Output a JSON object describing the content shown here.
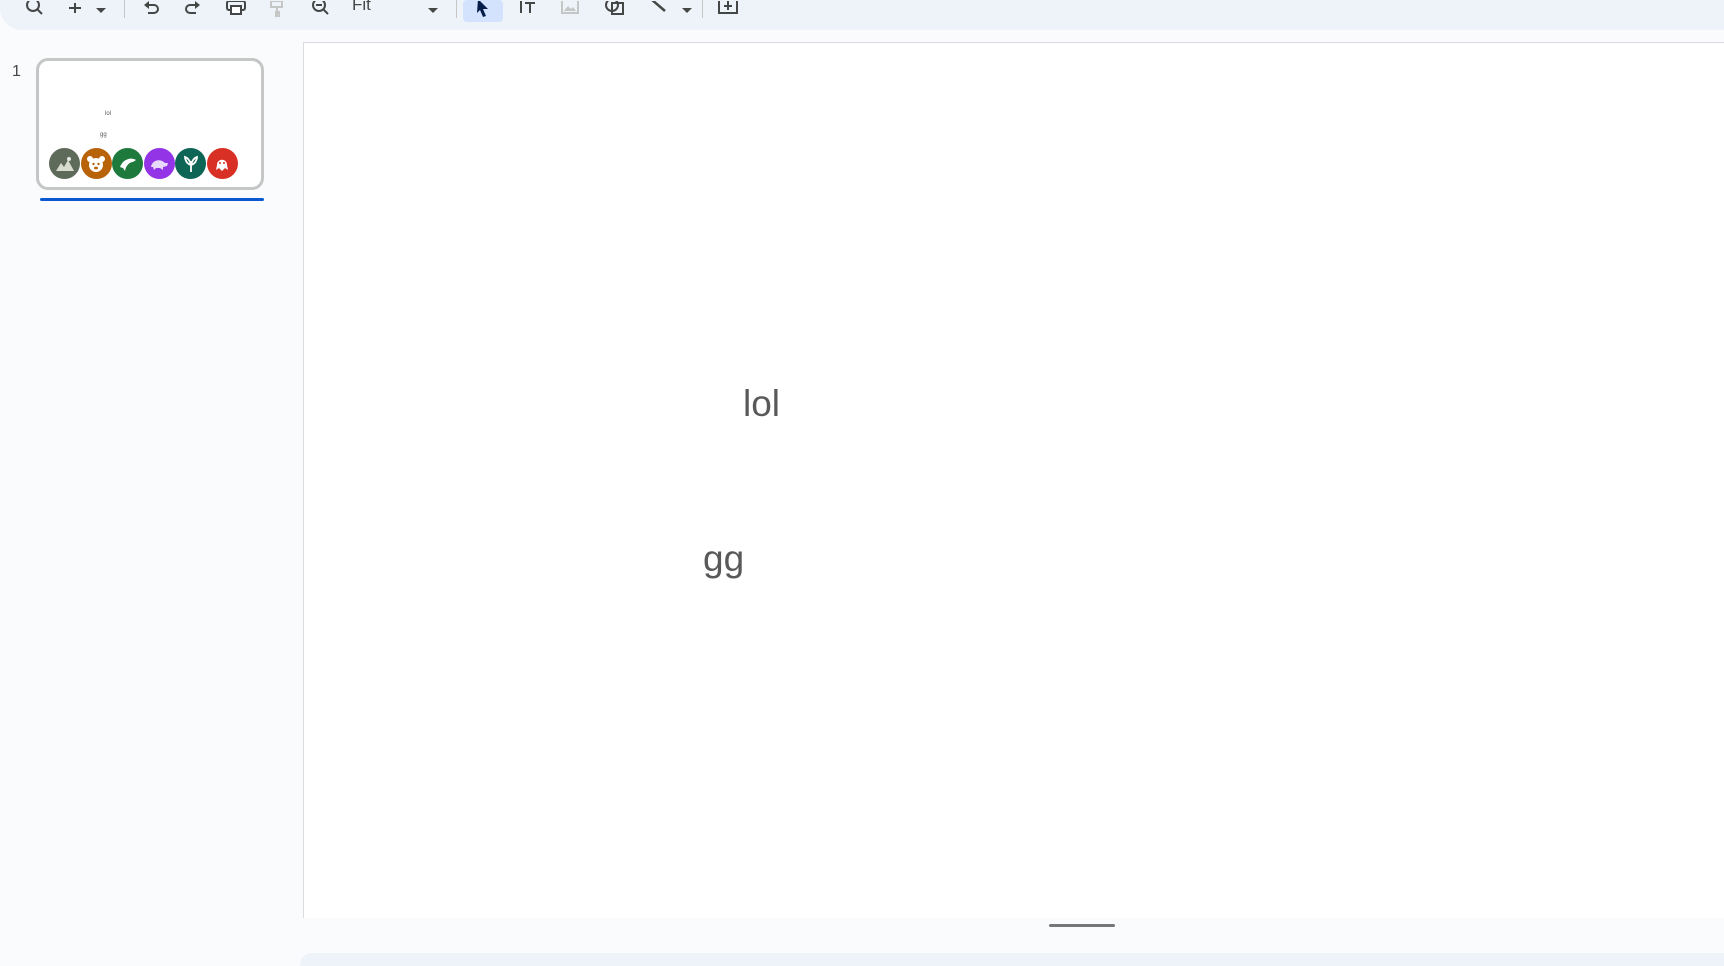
{
  "toolbar": {
    "zoom_value": "Fit",
    "icons": [
      "search-icon",
      "plus-icon",
      "dropdown-arrow-icon",
      "undo-icon",
      "redo-icon",
      "print-icon",
      "paint-format-icon",
      "zoom-icon",
      "dropdown-arrow-icon",
      "select-cursor-icon",
      "text-box-icon",
      "image-icon",
      "shape-icon",
      "line-icon",
      "dropdown-arrow-icon",
      "comment-add-icon"
    ]
  },
  "filmstrip": {
    "slides": [
      {
        "number": "1",
        "texts": [
          "lol",
          "gg"
        ]
      }
    ],
    "thumbnail_icons": [
      {
        "name": "photo-thumb-icon",
        "color": "#5f6b5a"
      },
      {
        "name": "bear-icon",
        "color": "#b8620a"
      },
      {
        "name": "dolphin-icon",
        "color": "#1e7a3c"
      },
      {
        "name": "tortoise-icon",
        "color": "#9334e6"
      },
      {
        "name": "plant-icon",
        "color": "#0d6655"
      },
      {
        "name": "octopus-icon",
        "color": "#d93025"
      }
    ]
  },
  "slide": {
    "text_lol": "lol",
    "text_gg": "gg"
  }
}
